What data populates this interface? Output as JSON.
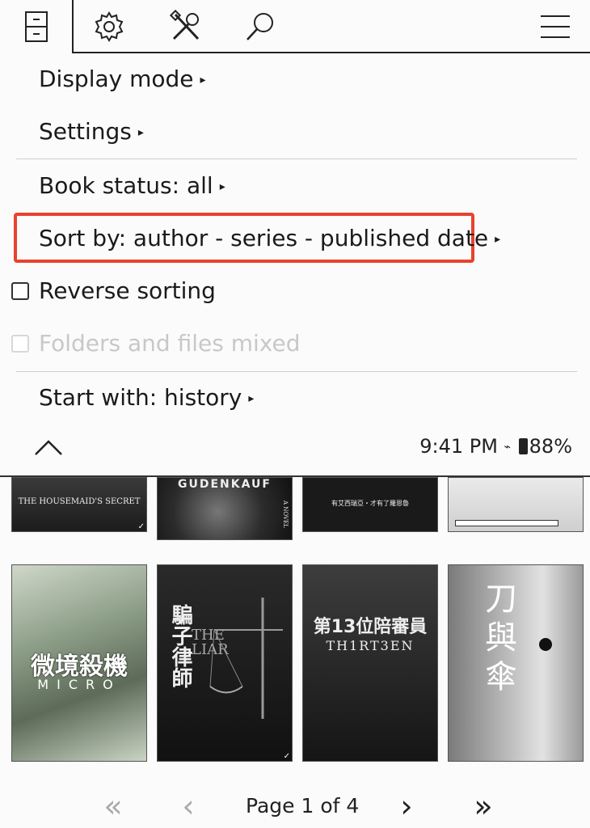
{
  "toolbar": {
    "icons": [
      "filebrowser-icon",
      "settings-gear-icon",
      "tools-icon",
      "search-icon",
      "hamburger-menu-icon"
    ]
  },
  "menu": {
    "display_mode": "Display mode",
    "settings": "Settings",
    "book_status": "Book status: all",
    "sort_by": "Sort by: author - series - published date",
    "reverse_sorting": "Reverse sorting",
    "folders_files_mixed": "Folders and files mixed",
    "start_with": "Start with: history",
    "arrow_glyph": "▸",
    "highlight_color": "#e8422d"
  },
  "status_bar": {
    "time": "9:41 PM",
    "battery": "88%"
  },
  "books_row1": [
    {
      "title": "THE HOUSEMAID'S SECRET"
    },
    {
      "title": "GUDENKAUF",
      "subtitle": "A NOVEL"
    },
    {
      "title": "有艾西瑞亞・才有了羅恩魯"
    },
    {
      "title": ""
    }
  ],
  "books_row2": [
    {
      "title_cn": "微境殺機",
      "title_en": "MICRO"
    },
    {
      "title_cn": "騙子律師",
      "title_en": "THE LIAR"
    },
    {
      "title_cn": "第13位陪審員",
      "title_en": "TH1RT3EN"
    },
    {
      "title_cn": "刀與傘",
      "title_en": ""
    }
  ],
  "footer": {
    "page_label": "Page 1 of 4",
    "first_glyph": "«",
    "prev_glyph": "‹",
    "next_glyph": "›",
    "last_glyph": "»"
  }
}
